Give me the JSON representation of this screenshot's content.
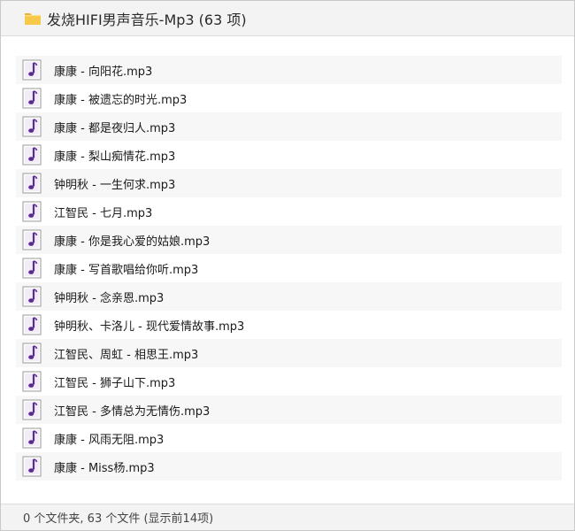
{
  "header": {
    "title": "发烧HIFI男声音乐-Mp3 (63 项)",
    "icon": "folder-icon"
  },
  "files": [
    {
      "name": "康康 - 向阳花.mp3",
      "icon": "music-file-icon"
    },
    {
      "name": "康康 - 被遗忘的时光.mp3",
      "icon": "music-file-icon"
    },
    {
      "name": "康康 - 都是夜归人.mp3",
      "icon": "music-file-icon"
    },
    {
      "name": "康康 - 梨山痴情花.mp3",
      "icon": "music-file-icon"
    },
    {
      "name": "钟明秋 - 一生何求.mp3",
      "icon": "music-file-icon"
    },
    {
      "name": "江智民 - 七月.mp3",
      "icon": "music-file-icon"
    },
    {
      "name": "康康 - 你是我心爱的姑娘.mp3",
      "icon": "music-file-icon"
    },
    {
      "name": "康康 - 写首歌唱给你听.mp3",
      "icon": "music-file-icon"
    },
    {
      "name": "钟明秋 - 念亲恩.mp3",
      "icon": "music-file-icon"
    },
    {
      "name": "钟明秋、卡洛儿 - 现代爱情故事.mp3",
      "icon": "music-file-icon"
    },
    {
      "name": "江智民、周虹 - 相思王.mp3",
      "icon": "music-file-icon"
    },
    {
      "name": "江智民 - 狮子山下.mp3",
      "icon": "music-file-icon"
    },
    {
      "name": "江智民 - 多情总为无情伤.mp3",
      "icon": "music-file-icon"
    },
    {
      "name": "康康 - 风雨无阻.mp3",
      "icon": "music-file-icon"
    },
    {
      "name": "康康 - Miss杨.mp3",
      "icon": "music-file-icon"
    }
  ],
  "footer": {
    "summary": "0 个文件夹, 63 个文件 (显示前14项)"
  },
  "colors": {
    "folder_yellow": "#f7c948",
    "file_icon_purple": "#5a2d8a",
    "row_alt_bg": "#f7f7f7"
  }
}
